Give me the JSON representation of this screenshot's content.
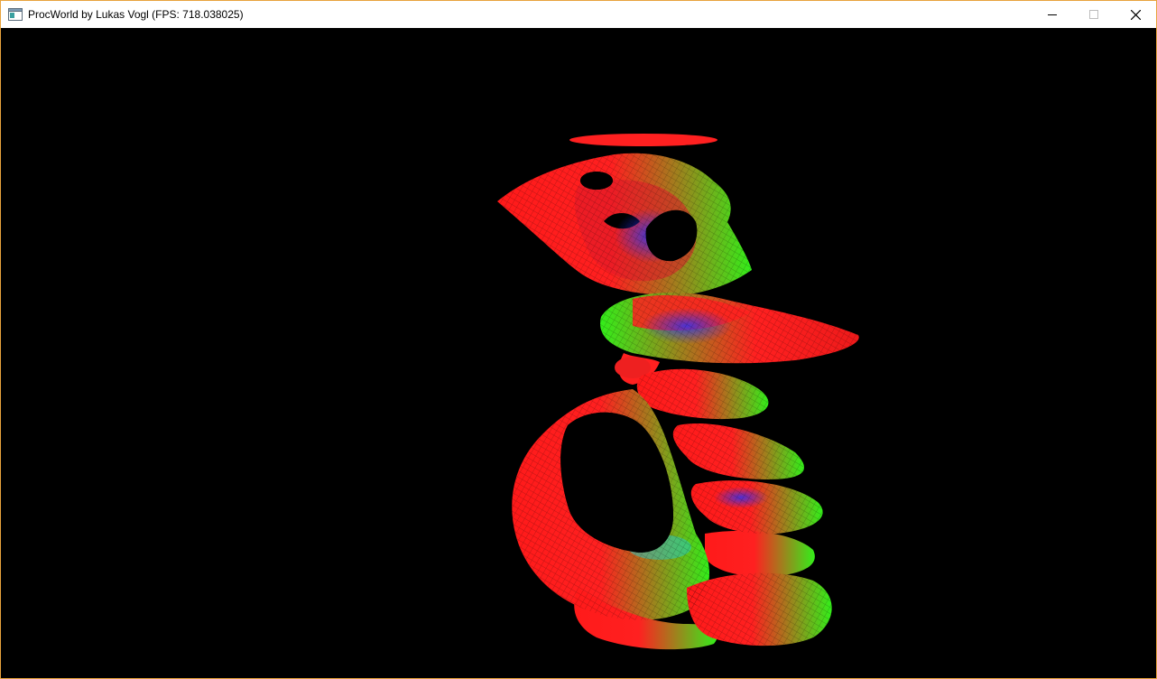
{
  "window": {
    "title": "ProcWorld by Lukas Vogl (FPS: 718.038025)",
    "border_color": "#e8a33d",
    "icon": "app-window-icon",
    "controls": {
      "minimize_icon": "minimize-icon",
      "maximize_icon": "maximize-icon",
      "close_icon": "close-icon"
    }
  },
  "viewport": {
    "background": "#000000",
    "scene": "procedural-mesh-wireframe",
    "mesh_colors": [
      "#ff1a1a",
      "#33ff1a",
      "#1a33ff",
      "#22cccc"
    ]
  }
}
